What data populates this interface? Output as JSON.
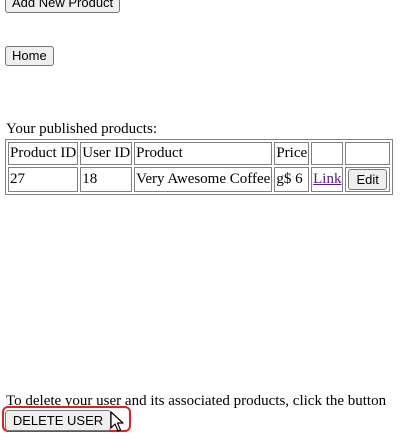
{
  "top": {
    "add_button": "Add New Product",
    "home_button": "Home"
  },
  "products_section": {
    "heading": "Your published products:",
    "columns": [
      "Product ID",
      "User ID",
      "Product",
      "Price",
      "",
      ""
    ],
    "rows": [
      {
        "product_id": "27",
        "user_id": "18",
        "product": "Very Awesome Coffee",
        "price": "g$ 6",
        "link_label": "Link",
        "edit_label": "Edit"
      }
    ]
  },
  "delete_section": {
    "text": "To delete your user and its associated products, click the button",
    "button": "DELETE USER"
  },
  "colors": {
    "highlight": "#e02020",
    "link": "#551a8b"
  },
  "icons": {
    "cursor": "pointer-cursor-icon"
  }
}
